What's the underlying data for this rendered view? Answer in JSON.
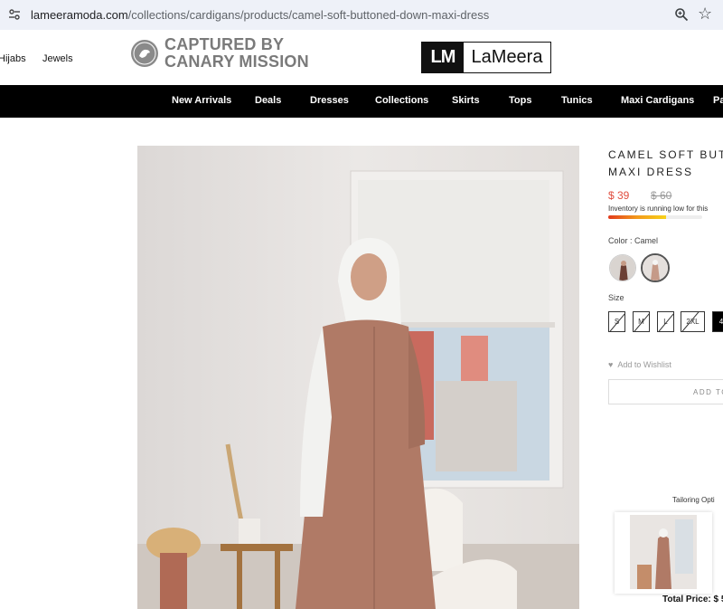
{
  "browser": {
    "url_domain": "lameeramoda.com",
    "url_path": "/collections/cardigans/products/camel-soft-buttoned-down-maxi-dress",
    "icons": [
      "tune-icon",
      "zoom-icon",
      "bookmark-star-icon"
    ]
  },
  "header": {
    "links": [
      "Hijabs",
      "Jewels"
    ],
    "overlay_line1": "CAPTURED BY",
    "overlay_line2": "CANARY MISSION",
    "logo_mark": "LM",
    "logo_name": "LaMeera"
  },
  "nav": {
    "items": [
      "New Arrivals",
      "Deals",
      "Dresses",
      "Collections",
      "Skirts",
      "Tops",
      "Tunics",
      "Maxi Cardigans",
      "Pa"
    ]
  },
  "product": {
    "title_line1": "CAMEL SOFT BUTT",
    "title_line2": "MAXI DRESS",
    "price": "$ 39",
    "old_price": "$ 60",
    "inventory_text": "Inventory is running low for this",
    "inventory_level": 0.62,
    "color_label": "Color : Camel",
    "size_label": "Size",
    "sizes": [
      "S",
      "M",
      "L",
      "2XL",
      "4"
    ],
    "wishlist": "Add to Wishlist",
    "add_to_cart": "ADD TO",
    "tailoring": "Tailoring Opti",
    "total_price": "Total Price: $ 5"
  },
  "colors": {
    "accent_price": "#e04d3e",
    "nav_bg": "#000000",
    "dress": "#b07a66"
  }
}
